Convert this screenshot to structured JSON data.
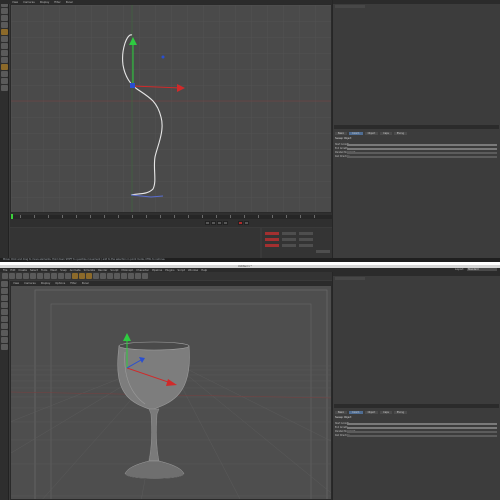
{
  "top_window": {
    "menu_items": [
      "View",
      "Cameras",
      "Display",
      "Filter",
      "Panel"
    ],
    "status_text": "Move: Click and drag to move elements. Hold down SHIFT to quantize movement / add to the selection in point mode, CTRL to remove.",
    "attributes": {
      "tabs": [
        "Basic",
        "Coord.",
        "Object",
        "Caps",
        "Phong"
      ],
      "section_title": "Sweep Object",
      "rows": [
        "Start Growth",
        "End Growth",
        "Parallel Movement",
        "Rail Direction"
      ]
    }
  },
  "bottom_window": {
    "title": "Untitled 1 *",
    "menu_items": [
      "File",
      "Edit",
      "Create",
      "Select",
      "Tools",
      "Mesh",
      "Snap",
      "Animate",
      "Simulate",
      "Render",
      "Sculpt",
      "MoGraph",
      "Character",
      "Pipeline",
      "Plugins",
      "Script",
      "Window",
      "Help"
    ],
    "layout_label": "Layout:",
    "layout_value": "Standard",
    "viewport_menu": [
      "View",
      "Cameras",
      "Display",
      "Options",
      "Filter",
      "Panel"
    ],
    "attributes": {
      "tabs": [
        "Basic",
        "Coord.",
        "Object",
        "Caps",
        "Phong"
      ],
      "section_title": "Sweep Object",
      "rows": [
        "Start Growth",
        "End Growth",
        "Parallel Movement",
        "Rail Direction"
      ]
    }
  },
  "colors": {
    "axis_x": "#d02a2a",
    "axis_y": "#2ecc40",
    "axis_z": "#2a4fd0",
    "selection_highlight": "#4f6d93",
    "timeline_marker": "#3bd13b"
  },
  "icons": [
    "move-icon",
    "scale-icon",
    "rotate-icon",
    "undo-icon",
    "play-icon",
    "record-icon",
    "key-icon"
  ]
}
